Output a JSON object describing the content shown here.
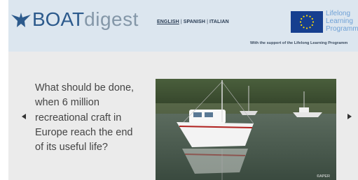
{
  "header": {
    "logo": {
      "part1": "BOAT",
      "part2": "digest",
      "icon": "boat-logo-icon"
    },
    "languages": [
      {
        "label": "ENGLISH",
        "active": true
      },
      {
        "label": "SPANISH",
        "active": false
      },
      {
        "label": "ITALIAN",
        "active": false
      }
    ],
    "lifelong_lines": [
      "Lifelong",
      "Learning",
      "Programm"
    ],
    "support_text": "With the support of the Lifelong Learning Programm"
  },
  "hero": {
    "question_lines": [
      "What should be done,",
      "when 6 million",
      "recreational craft in",
      "Europe reach the end",
      "of its useful life?"
    ],
    "prev_icon": "chevron-left-icon",
    "next_icon": "chevron-right-icon",
    "photo_credit": "©APER"
  },
  "colors": {
    "header_bg": "#dce6ef",
    "hero_bg": "#ebebeb",
    "logo_blue": "#2c5a8c",
    "logo_grey": "#8497a8",
    "eu_blue": "#163f8f",
    "eu_star": "#ffdd00"
  }
}
